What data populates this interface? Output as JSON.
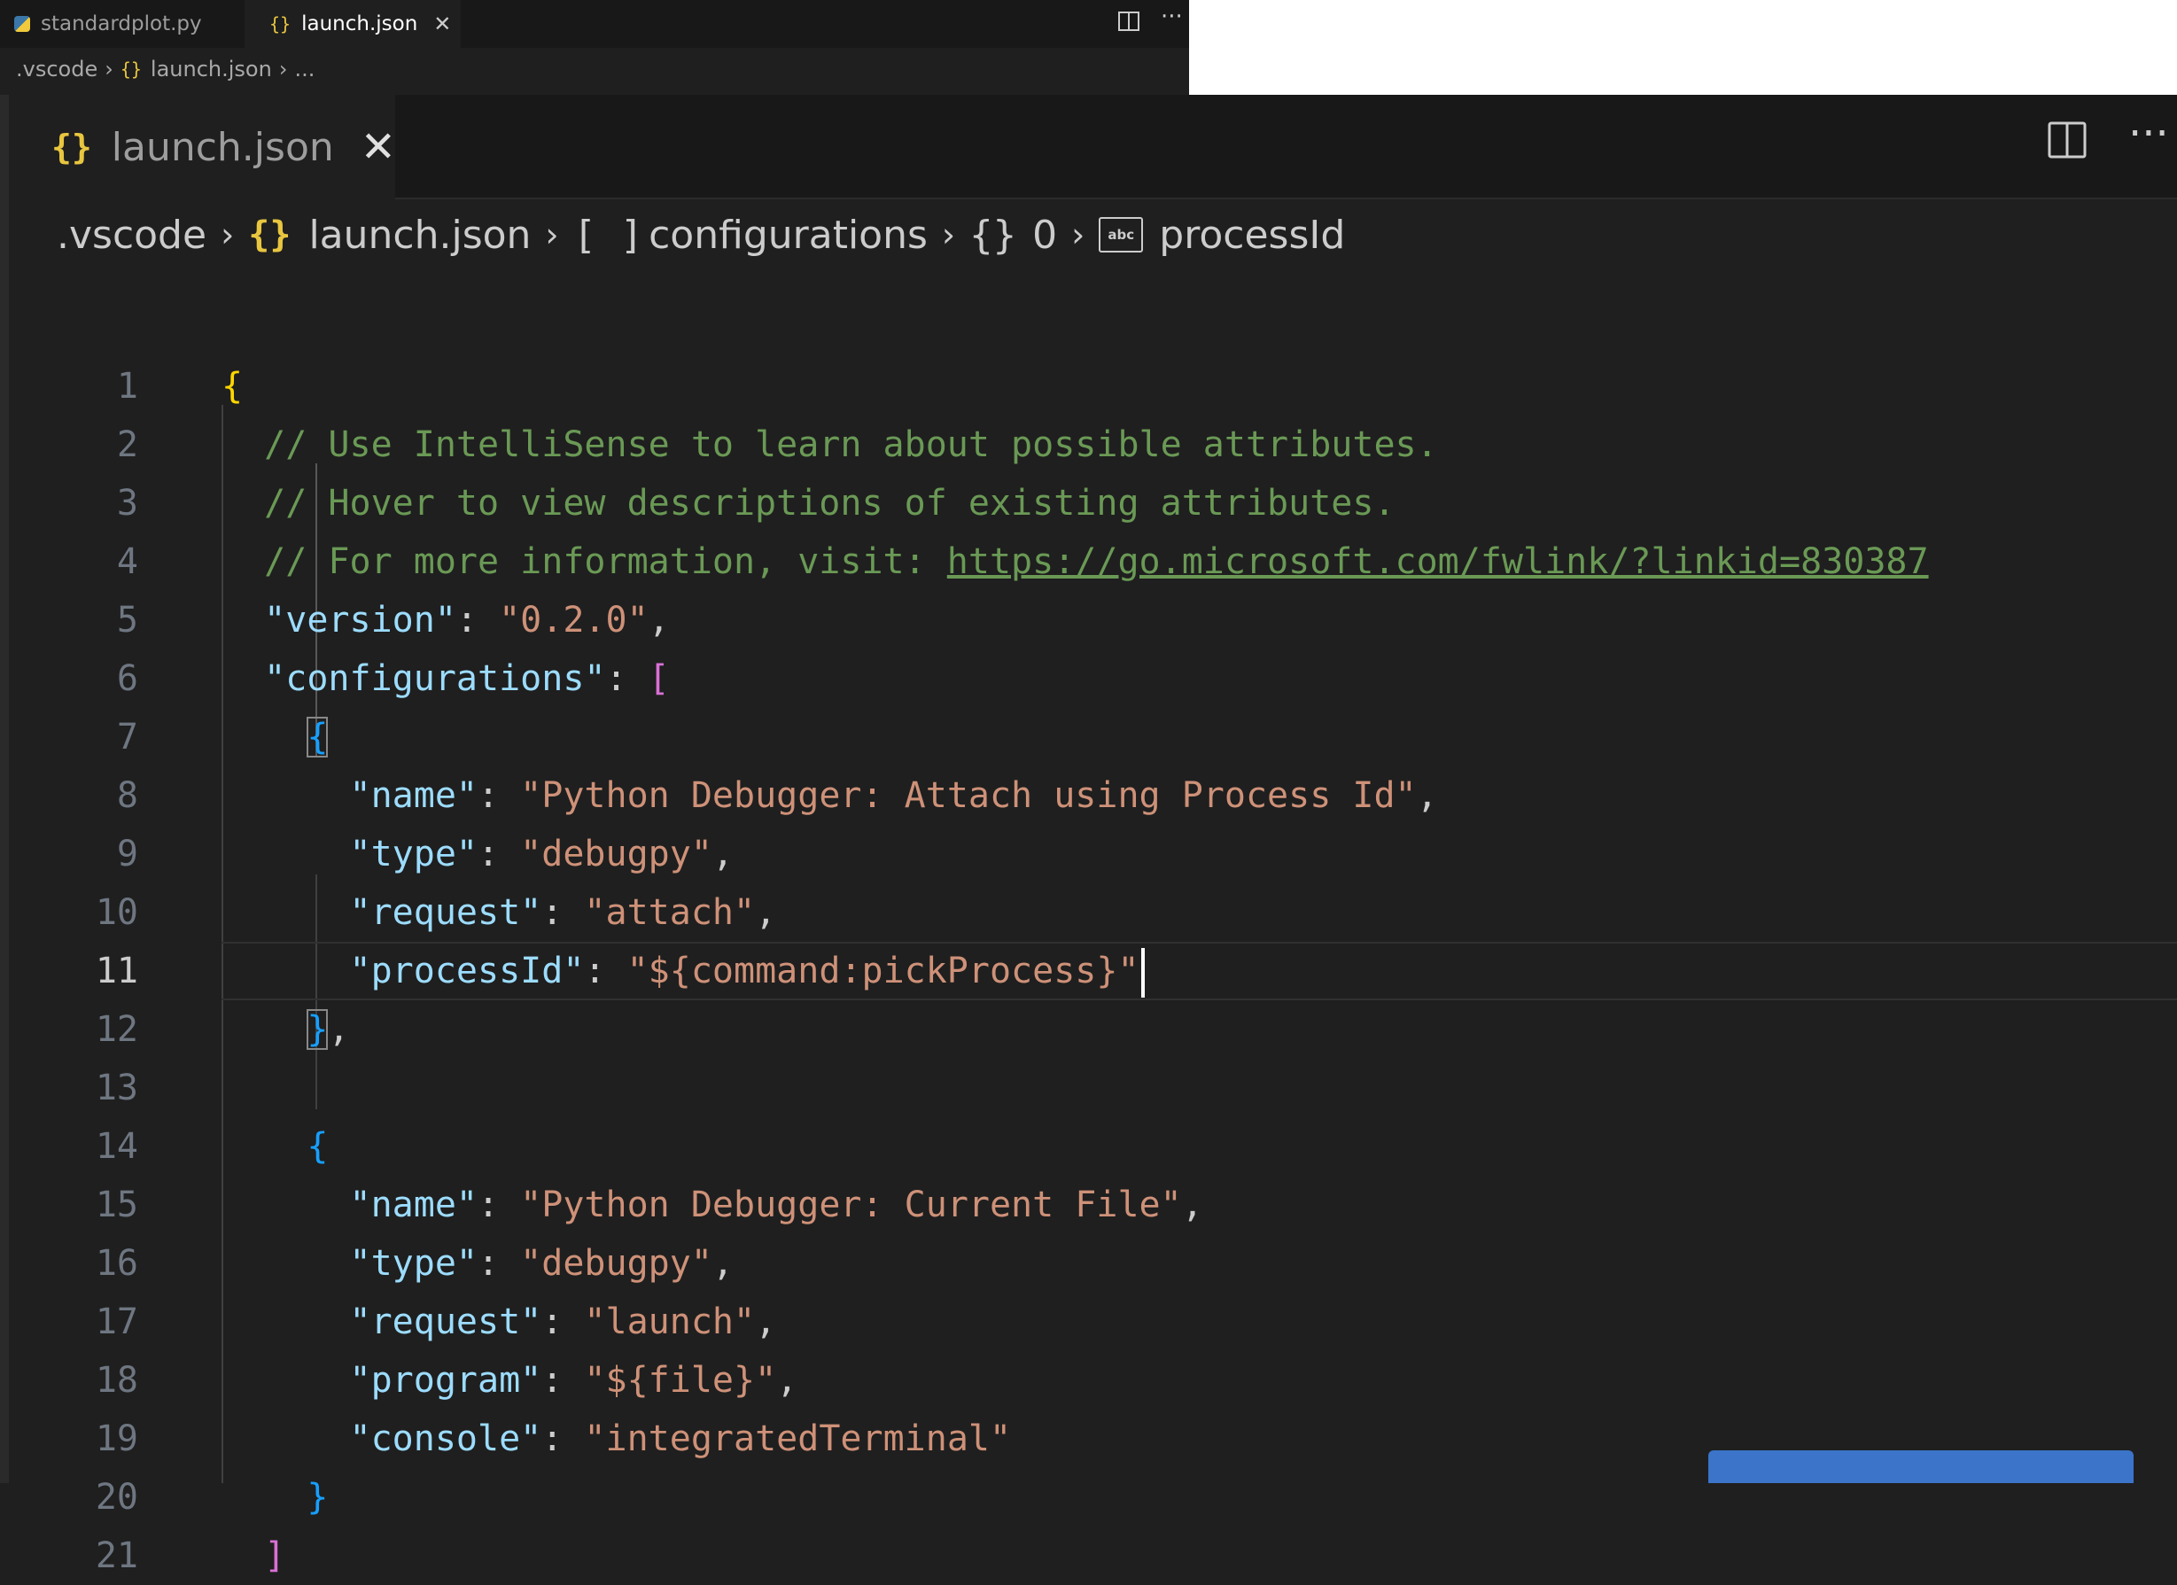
{
  "mini_editor": {
    "tabs": [
      {
        "label": "standardplot.py",
        "icon": "python-file-icon"
      },
      {
        "label": "launch.json",
        "icon": "json-braces-icon"
      }
    ],
    "close_glyph": "✕",
    "more_glyph": "···",
    "breadcrumb": {
      "folder": ".vscode",
      "file": "launch.json",
      "ellipsis": "..."
    }
  },
  "editor": {
    "tab": {
      "icon_glyph": "{}",
      "label": "launch.json",
      "close_glyph": "✕"
    },
    "more_glyph": "···",
    "breadcrumb": {
      "folder": ".vscode",
      "file_icon": "{}",
      "file": "launch.json",
      "array_icon": "[ ]",
      "array": "configurations",
      "object_icon": "{}",
      "index": "0",
      "string_icon": "abc",
      "property": "processId"
    },
    "active_line": 11,
    "lines": [
      {
        "n": "1"
      },
      {
        "n": "2"
      },
      {
        "n": "3"
      },
      {
        "n": "4"
      },
      {
        "n": "5"
      },
      {
        "n": "6"
      },
      {
        "n": "7"
      },
      {
        "n": "8"
      },
      {
        "n": "9"
      },
      {
        "n": "10"
      },
      {
        "n": "11"
      },
      {
        "n": "12"
      },
      {
        "n": "13"
      },
      {
        "n": "14"
      },
      {
        "n": "15"
      },
      {
        "n": "16"
      },
      {
        "n": "17"
      },
      {
        "n": "18"
      },
      {
        "n": "19"
      },
      {
        "n": "20"
      },
      {
        "n": "21"
      }
    ],
    "code": {
      "l1_open": "{",
      "l2_comment": "// Use IntelliSense to learn about possible attributes.",
      "l3_comment": "// Hover to view descriptions of existing attributes.",
      "l4_comment": "// For more information, visit: ",
      "l4_link": "https://go.microsoft.com/fwlink/?linkid=830387",
      "l5_key": "\"version\"",
      "l5_val": "\"0.2.0\"",
      "l6_key": "\"configurations\"",
      "l6_open": "[",
      "l7_open": "{",
      "l8_key": "\"name\"",
      "l8_val": "\"Python Debugger: Attach using Process Id\"",
      "l9_key": "\"type\"",
      "l9_val": "\"debugpy\"",
      "l10_key": "\"request\"",
      "l10_val": "\"attach\"",
      "l11_key": "\"processId\"",
      "l11_val": "\"${command:pickProcess}\"",
      "l12_close": "}",
      "l14_open": "{",
      "l15_key": "\"name\"",
      "l15_val": "\"Python Debugger: Current File\"",
      "l16_key": "\"type\"",
      "l16_val": "\"debugpy\"",
      "l17_key": "\"request\"",
      "l17_val": "\"launch\"",
      "l18_key": "\"program\"",
      "l18_val": "\"${file}\"",
      "l19_key": "\"console\"",
      "l19_val": "\"integratedTerminal\"",
      "l20_close": "}",
      "l21_close": "]"
    }
  },
  "colors": {
    "editor_bg": "#1f1f1f",
    "key": "#9cdcfe",
    "string": "#ce9178",
    "comment": "#6a9955",
    "bracket_gold": "#ffd700",
    "bracket_orchid": "#da70d6",
    "bracket_blue": "#179fff",
    "file_icon_yellow": "#e8c63f"
  }
}
